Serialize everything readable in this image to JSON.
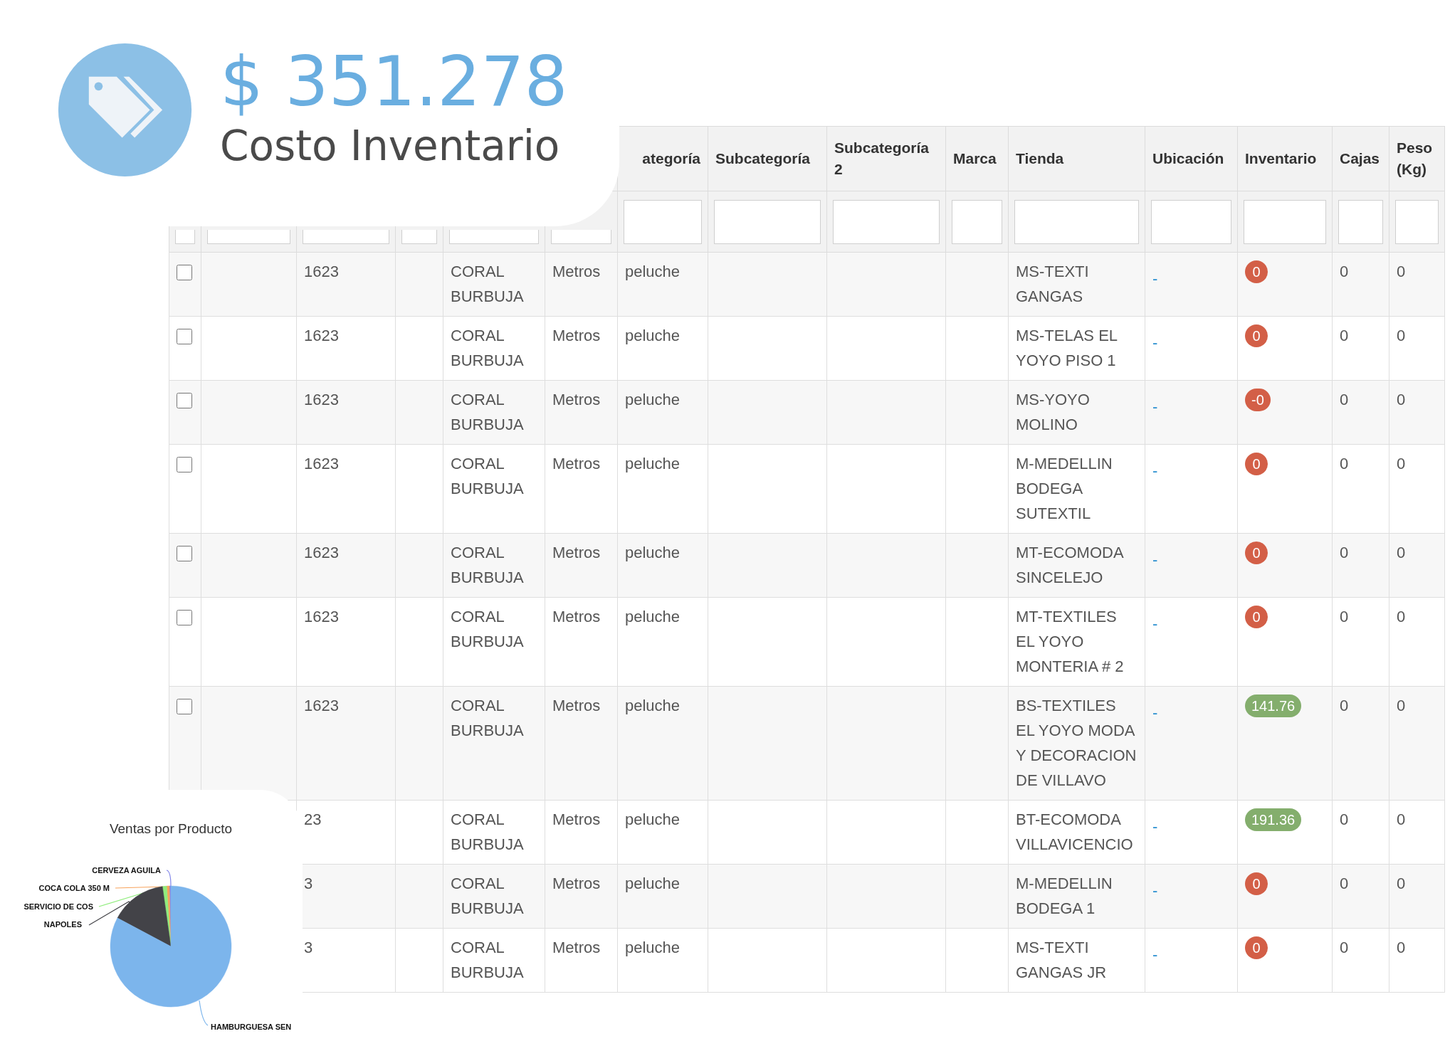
{
  "summary_card": {
    "amount": "$ 351.278",
    "label": "Costo Inventario"
  },
  "table": {
    "headers": [
      "ategoría",
      "Subcategoría",
      "Subcategoría 2",
      "Marca",
      "Tienda",
      "Ubicación",
      "Inventario",
      "Cajas",
      "Peso (Kg)"
    ],
    "rows": [
      {
        "checked": false,
        "code": "1623",
        "product": "CORAL BURBUJA",
        "unit": "Metros",
        "category": "peluche",
        "store": "MS-TEXTI GANGAS",
        "location": "-",
        "inventory": {
          "text": "0",
          "color": "#d35f47"
        },
        "boxes": "0",
        "weight": "0"
      },
      {
        "checked": false,
        "code": "1623",
        "product": "CORAL BURBUJA",
        "unit": "Metros",
        "category": "peluche",
        "store": "MS-TELAS EL YOYO PISO 1",
        "location": "-",
        "inventory": {
          "text": "0",
          "color": "#d35f47"
        },
        "boxes": "0",
        "weight": "0"
      },
      {
        "checked": false,
        "code": "1623",
        "product": "CORAL BURBUJA",
        "unit": "Metros",
        "category": "peluche",
        "store": "MS-YOYO MOLINO",
        "location": "-",
        "inventory": {
          "text": "-0",
          "color": "#d35f47"
        },
        "boxes": "0",
        "weight": "0"
      },
      {
        "checked": false,
        "code": "1623",
        "product": "CORAL BURBUJA",
        "unit": "Metros",
        "category": "peluche",
        "store": "M-MEDELLIN BODEGA SUTEXTIL",
        "location": "-",
        "inventory": {
          "text": "0",
          "color": "#d35f47"
        },
        "boxes": "0",
        "weight": "0"
      },
      {
        "checked": false,
        "code": "1623",
        "product": "CORAL BURBUJA",
        "unit": "Metros",
        "category": "peluche",
        "store": "MT-ECOMODA SINCELEJO",
        "location": "-",
        "inventory": {
          "text": "0",
          "color": "#d35f47"
        },
        "boxes": "0",
        "weight": "0"
      },
      {
        "checked": false,
        "code": "1623",
        "product": "CORAL BURBUJA",
        "unit": "Metros",
        "category": "peluche",
        "store": "MT-TEXTILES EL YOYO MONTERIA # 2",
        "location": "-",
        "inventory": {
          "text": "0",
          "color": "#d35f47"
        },
        "boxes": "0",
        "weight": "0"
      },
      {
        "checked": false,
        "code": "1623",
        "product": "CORAL BURBUJA",
        "unit": "Metros",
        "category": "peluche",
        "store": "BS-TEXTILES EL YOYO MODA Y DECORACION DE VILLAVO",
        "location": "-",
        "inventory": {
          "text": "141.76",
          "color": "#84ae6d"
        },
        "boxes": "0",
        "weight": "0"
      },
      {
        "code": "23",
        "product": "CORAL BURBUJA",
        "unit": "Metros",
        "category": "peluche",
        "store": "BT-ECOMODA VILLAVICENCIO",
        "location": "-",
        "inventory": {
          "text": "191.36",
          "color": "#84ae6d"
        },
        "boxes": "0",
        "weight": "0"
      },
      {
        "code": "3",
        "product": "CORAL BURBUJA",
        "unit": "Metros",
        "category": "peluche",
        "store": "M-MEDELLIN BODEGA 1",
        "location": "-",
        "inventory": {
          "text": "0",
          "color": "#d35f47"
        },
        "boxes": "0",
        "weight": "0"
      },
      {
        "code": "3",
        "product": "CORAL BURBUJA",
        "unit": "Metros",
        "category": "peluche",
        "store": "MS-TEXTI GANGAS JR",
        "location": "-",
        "inventory": {
          "text": "0",
          "color": "#d35f47"
        },
        "boxes": "0",
        "weight": "0"
      }
    ]
  },
  "sales_chart": {
    "title": "Ventas por Producto",
    "labels": [
      {
        "text": "CERVEZA AGUILA",
        "color": "#8085e9"
      },
      {
        "text": "COCA COLA 350 M",
        "color": "#f7a35c"
      },
      {
        "text": "SERVICIO DE COS",
        "color": "#90ed7d"
      },
      {
        "text": "NAPOLES",
        "color": "#434348"
      },
      {
        "text": "HAMBURGUESA SEN",
        "color": "#7cb5ec"
      }
    ]
  }
}
